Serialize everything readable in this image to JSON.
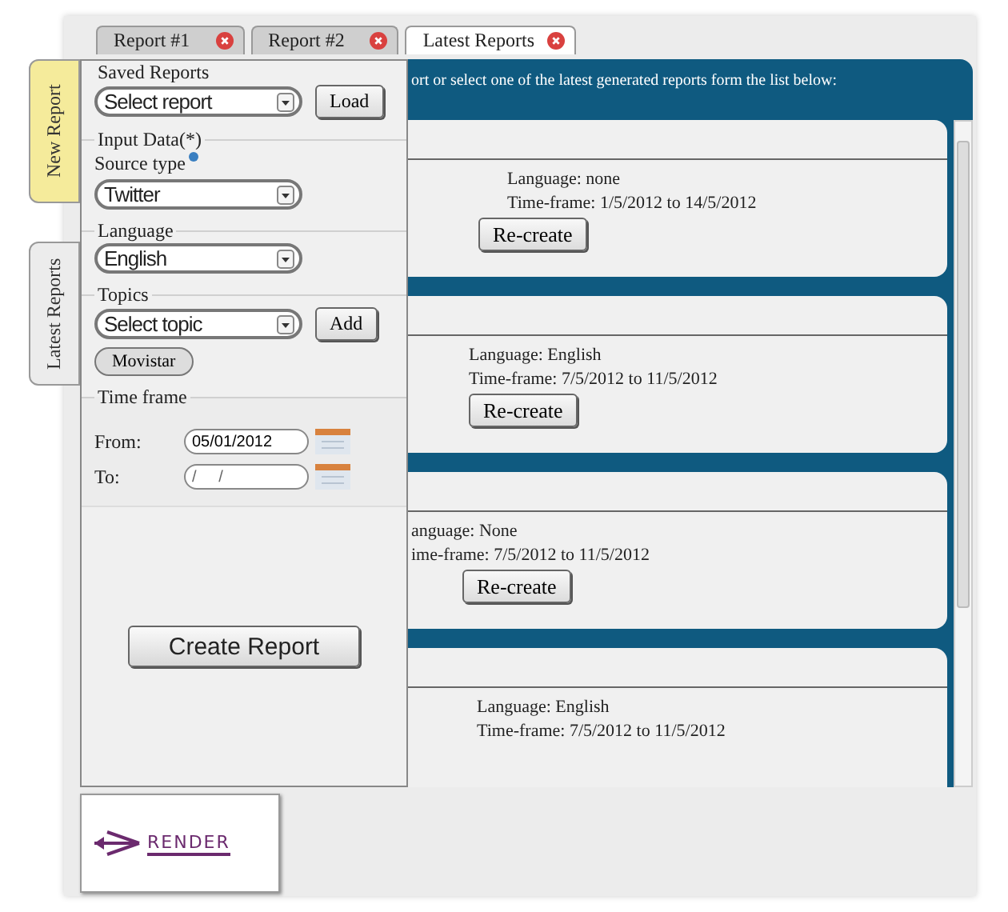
{
  "tabs": [
    {
      "label": "Report #1",
      "selected": false
    },
    {
      "label": "Report #2",
      "selected": false
    },
    {
      "label": "Latest Reports",
      "selected": true
    }
  ],
  "side_tabs": [
    {
      "label": "New Report",
      "selected": true
    },
    {
      "label": "Latest Reports",
      "selected": false
    }
  ],
  "form": {
    "saved_reports": {
      "legend": "Saved Reports",
      "select": "Select report",
      "button": "Load"
    },
    "input_data": {
      "legend": "Input Data(*)",
      "label": "Source type",
      "select": "Twitter"
    },
    "language": {
      "legend": "Language",
      "select": "English"
    },
    "topics": {
      "legend": "Topics",
      "select": "Select topic",
      "button": "Add",
      "chips": [
        "Movistar"
      ]
    },
    "time_frame": {
      "legend": "Time frame",
      "from_label": "From:",
      "from_value": "05/01/2012",
      "to_label": "To:",
      "to_placeholder": "/     /"
    },
    "create_button": "Create Report"
  },
  "intro": "ort or select one of the latest generated reports form the list below:",
  "reports": [
    {
      "language": "Language: none",
      "time_frame": "Time-frame: 1/5/2012 to 14/5/2012",
      "button": "Re-create"
    },
    {
      "language": "Language: English",
      "time_frame": "Time-frame: 7/5/2012 to 11/5/2012",
      "button": "Re-create"
    },
    {
      "language": "anguage: None",
      "time_frame": "ime-frame: 7/5/2012 to 11/5/2012",
      "button": "Re-create"
    },
    {
      "language": "Language: English",
      "time_frame": "Time-frame: 7/5/2012 to 11/5/2012"
    }
  ],
  "logo": {
    "text": "RENDER"
  }
}
